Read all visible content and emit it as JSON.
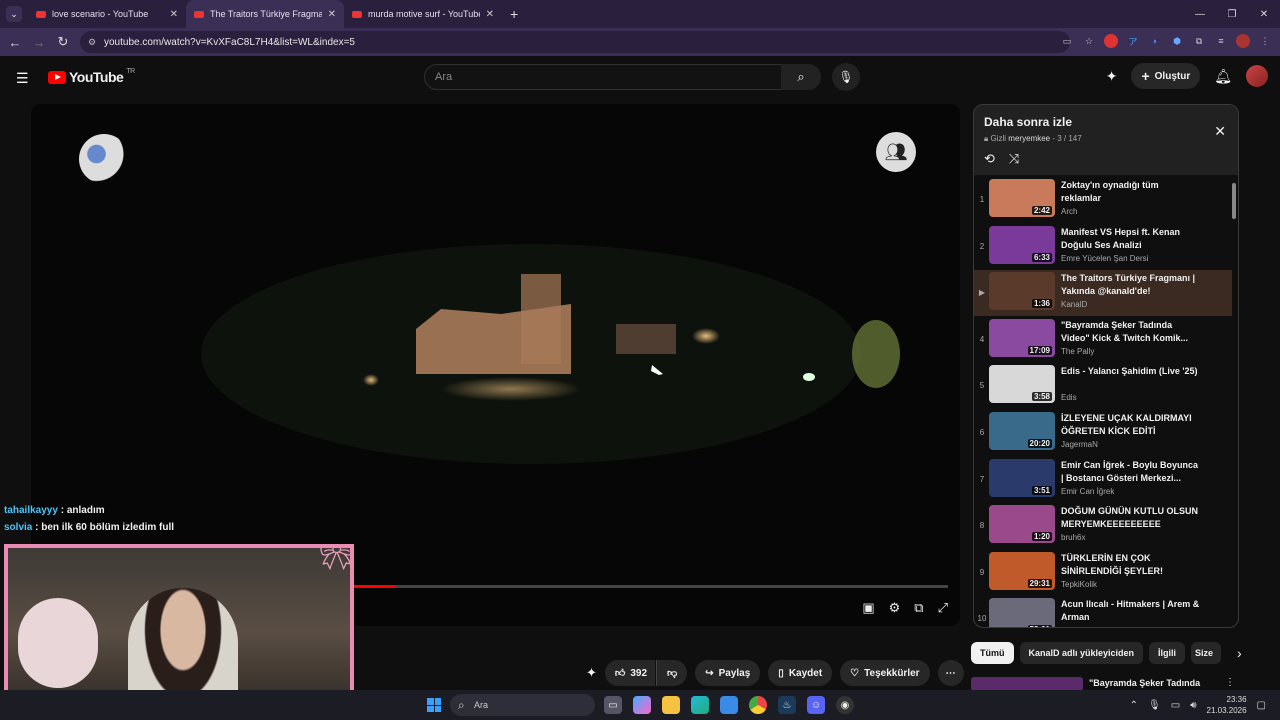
{
  "browser": {
    "tabs": [
      {
        "title": "love scenario - YouTube",
        "active": false
      },
      {
        "title": "The Traitors Türkiye Fragmanı |",
        "active": true
      },
      {
        "title": "murda motive surf - YouTube",
        "active": false
      }
    ],
    "url": "youtube.com/watch?v=KvXFaC8L7H4&list=WL&index=5"
  },
  "youtube": {
    "logo_text": "YouTube",
    "region": "TR",
    "search_placeholder": "Ara",
    "create_label": "Oluştur"
  },
  "overlay_chat": [
    {
      "user": "tahailkayyy",
      "message": " : anladım"
    },
    {
      "user": "solvia",
      "message": " : ben ilk 60 bölüm izledim full"
    }
  ],
  "actions": {
    "like_count": "392",
    "share": "Paylaş",
    "save": "Kaydet",
    "thanks": "Teşekkürler"
  },
  "playlist": {
    "title": "Daha sonra izle",
    "privacy": "Gizli",
    "owner": "meryemkee",
    "position": "3 / 147",
    "items": [
      {
        "num": "1",
        "title": "Zoktay'ın oynadığı tüm reklamlar",
        "channel": "Arch",
        "duration": "2:42",
        "thumb": "#c97a5a",
        "current": false
      },
      {
        "num": "2",
        "title": "Manifest VS Hepsi ft. Kenan Doğulu Ses Analizi",
        "channel": "Emre Yücelen Şan Dersi",
        "duration": "6:33",
        "thumb": "#7a3a9a",
        "current": false
      },
      {
        "num": "▶",
        "title": "The Traitors Türkiye Fragmanı | Yakında @kanald'de!",
        "channel": "KanalD",
        "duration": "1:36",
        "thumb": "#5a3a2a",
        "current": true
      },
      {
        "num": "4",
        "title": "\"Bayramda Şeker Tadında Video\" Kick & Twitch Komik...",
        "channel": "The Pally",
        "duration": "17:09",
        "thumb": "#8a4aa0",
        "current": false
      },
      {
        "num": "5",
        "title": "Edis - Yalancı Şahidim (Live '25)",
        "channel": "Edis",
        "duration": "3:58",
        "thumb": "#d8d8d8",
        "current": false
      },
      {
        "num": "6",
        "title": "İZLEYENE UÇAK KALDIRMAYI ÖĞRETEN KİCK EDİTİ",
        "channel": "JagermaN",
        "duration": "20:20",
        "thumb": "#3a6a8a",
        "current": false
      },
      {
        "num": "7",
        "title": "Emir Can İğrek - Boylu Boyunca | Bostancı Gösteri Merkezi...",
        "channel": "Emir Can İğrek",
        "duration": "3:51",
        "thumb": "#2a3a6a",
        "current": false
      },
      {
        "num": "8",
        "title": "DOĞUM GÜNÜN KUTLU OLSUN MERYEMKEEEEEEEEE",
        "channel": "bruh6x",
        "duration": "1:20",
        "thumb": "#9a4a8a",
        "current": false
      },
      {
        "num": "9",
        "title": "TÜRKLERİN EN ÇOK SİNİRLENDİĞİ ŞEYLER!",
        "channel": "TepkiKolik",
        "duration": "29:31",
        "thumb": "#c05a2a",
        "current": false
      },
      {
        "num": "10",
        "title": "Acun Ilıcalı - Hitmakers | Arem & Arman",
        "channel": "",
        "duration": "58:01",
        "thumb": "#6a6a7a",
        "current": false
      }
    ]
  },
  "chips": [
    "Tümü",
    "KanalD adlı yükleyiciden",
    "İlgili",
    "Size"
  ],
  "recommendation_title": "\"Bayramda Şeker Tadında",
  "taskbar": {
    "search": "Ara",
    "time": "23:36",
    "date": "21.03.2026"
  },
  "player": {
    "progress": 0.39
  }
}
